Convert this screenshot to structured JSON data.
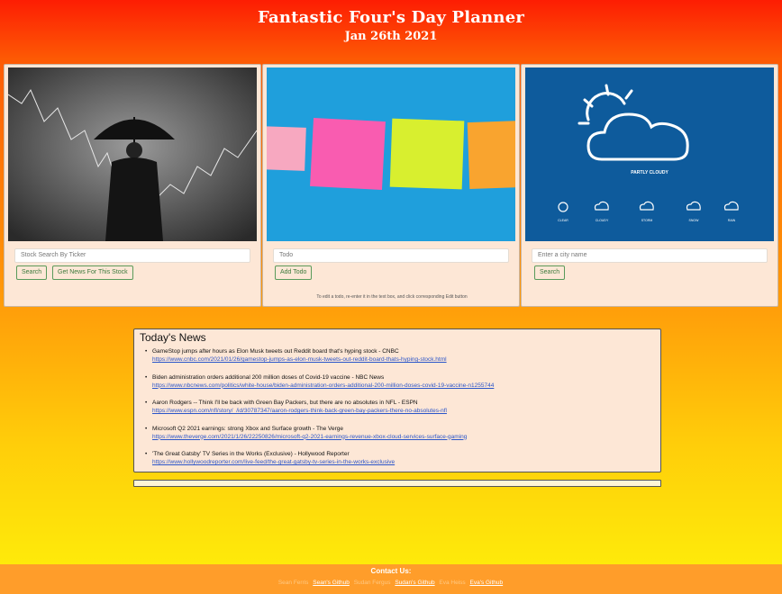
{
  "header": {
    "title": "Fantastic Four's Day Planner",
    "date": "Jan 26th 2021"
  },
  "stock_card": {
    "input_placeholder": "Stock Search By Ticker",
    "search_label": "Search",
    "news_label": "Get News For This Stock"
  },
  "todo_card": {
    "input_placeholder": "Todo",
    "add_label": "Add Todo",
    "hint": "To edit a todo, re-enter it in the text box, and click corresponding Edit button"
  },
  "weather_card": {
    "input_placeholder": "Enter a city name",
    "search_label": "Search",
    "image_title": "PARTLY CLOUDY",
    "icon_labels": [
      "CLEAR",
      "CLOUDY",
      "STORM",
      "SNOW",
      "RAIN"
    ]
  },
  "news": {
    "title": "Today's News",
    "items": [
      {
        "headline": "GameStop jumps after hours as Elon Musk tweets out Reddit board that's hyping stock - CNBC",
        "url": "https://www.cnbc.com/2021/01/26/gamestop-jumps-as-elon-musk-tweets-out-reddit-board-thats-hyping-stock.html"
      },
      {
        "headline": "Biden administration orders additional 200 million doses of Covid-19 vaccine - NBC News",
        "url": "https://www.nbcnews.com/politics/white-house/biden-administration-orders-additional-200-million-doses-covid-19-vaccine-n1255744"
      },
      {
        "headline": "Aaron Rodgers -- Think I'll be back with Green Bay Packers, but there are no absolutes in NFL - ESPN",
        "url": "https://www.espn.com/nfl/story/_/id/30787347/aaron-rodgers-think-back-green-bay-packers-there-no-absolutes-nfl"
      },
      {
        "headline": "Microsoft Q2 2021 earnings: strong Xbox and Surface growth - The Verge",
        "url": "https://www.theverge.com/2021/1/26/22250826/microsoft-q2-2021-earnings-revenue-xbox-cloud-services-surface-gaming"
      },
      {
        "headline": "'The Great Gatsby' TV Series in the Works (Exclusive) - Hollywood Reporter",
        "url": "https://www.hollywoodreporter.com/live-feed/the-great-gatsby-tv-series-in-the-works-exclusive"
      }
    ]
  },
  "footer": {
    "contact": "Contact Us:",
    "links": [
      {
        "prefix": "Sean Ferris",
        "label": "Sean's Github"
      },
      {
        "prefix": "Sudan Fergus",
        "label": "Sudan's Github"
      },
      {
        "prefix": "Eva Heiss",
        "label": "Eva's Github"
      }
    ]
  },
  "colors": {
    "header_red": "#fd1d03",
    "gradient_orange": "#ff9a0a",
    "gradient_yellow": "#fdf10a",
    "card_bg": "#fde7d6",
    "button_green": "#3c7a3c",
    "link_blue": "#2b55c9",
    "footer_bg": "#ff9d2a"
  }
}
